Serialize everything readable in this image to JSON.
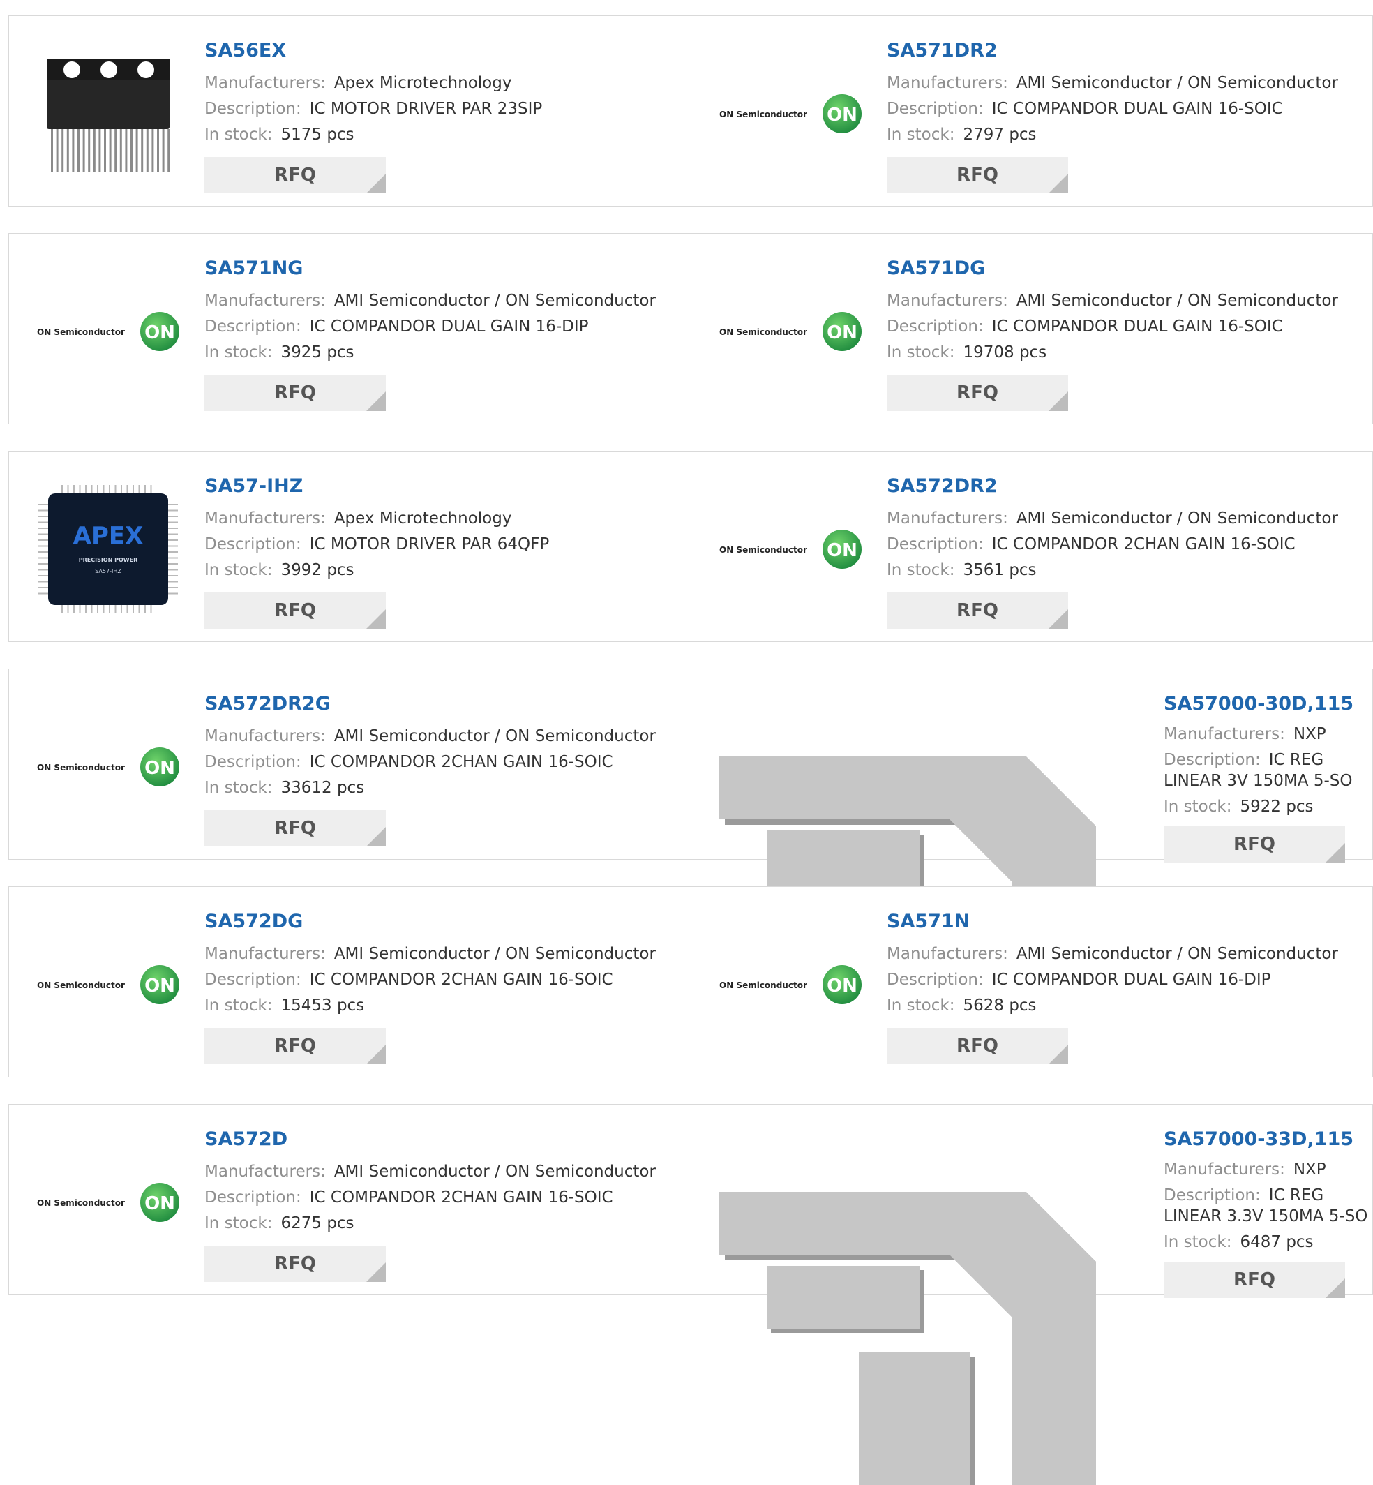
{
  "labels": {
    "manufacturers": "Manufacturers:",
    "description": "Description:",
    "in_stock": "In stock:",
    "rfq": "RFQ"
  },
  "brand_logo": {
    "name": "ON Semiconductor",
    "mark": "ON",
    "color": "#1e8a3e"
  },
  "rows": [
    {
      "left": {
        "image": "ic-23sip",
        "part": "SA56EX",
        "manufacturer": "Apex Microtechnology",
        "description": "IC MOTOR DRIVER PAR 23SIP",
        "stock": "5175 pcs"
      },
      "right": {
        "image": "on-semi-logo",
        "part": "SA571DR2",
        "manufacturer": "AMI Semiconductor / ON Semiconductor",
        "description": "IC COMPANDOR DUAL GAIN 16-SOIC",
        "stock": "2797 pcs"
      }
    },
    {
      "left": {
        "image": "on-semi-logo",
        "part": "SA571NG",
        "manufacturer": "AMI Semiconductor / ON Semiconductor",
        "description": "IC COMPANDOR DUAL GAIN 16-DIP",
        "stock": "3925 pcs"
      },
      "right": {
        "image": "on-semi-logo",
        "part": "SA571DG",
        "manufacturer": "AMI Semiconductor / ON Semiconductor",
        "description": "IC COMPANDOR DUAL GAIN 16-SOIC",
        "stock": "19708 pcs"
      }
    },
    {
      "left": {
        "image": "apex-qfp",
        "part": "SA57-IHZ",
        "manufacturer": "Apex Microtechnology",
        "description": "IC MOTOR DRIVER PAR 64QFP",
        "stock": "3992 pcs",
        "image_text": [
          "APEX",
          "PRECISION POWER",
          "SA57-IHZ"
        ]
      },
      "right": {
        "image": "on-semi-logo",
        "part": "SA572DR2",
        "manufacturer": "AMI Semiconductor / ON Semiconductor",
        "description": "IC COMPANDOR 2CHAN GAIN 16-SOIC",
        "stock": "3561 pcs"
      }
    },
    {
      "left": {
        "image": "on-semi-logo",
        "part": "SA572DR2G",
        "manufacturer": "AMI Semiconductor / ON Semiconductor",
        "description": "IC COMPANDOR 2CHAN GAIN 16-SOIC",
        "stock": "33612 pcs"
      },
      "right": {
        "image": "placeholder",
        "part": "SA57000-30D,115",
        "manufacturer": "NXP",
        "description": "IC REG LINEAR 3V 150MA 5-SO",
        "stock": "5922 pcs"
      }
    },
    {
      "left": {
        "image": "on-semi-logo",
        "part": "SA572DG",
        "manufacturer": "AMI Semiconductor / ON Semiconductor",
        "description": "IC COMPANDOR 2CHAN GAIN 16-SOIC",
        "stock": "15453 pcs"
      },
      "right": {
        "image": "on-semi-logo",
        "part": "SA571N",
        "manufacturer": "AMI Semiconductor / ON Semiconductor",
        "description": "IC COMPANDOR DUAL GAIN 16-DIP",
        "stock": "5628 pcs"
      }
    },
    {
      "left": {
        "image": "on-semi-logo",
        "part": "SA572D",
        "manufacturer": "AMI Semiconductor / ON Semiconductor",
        "description": "IC COMPANDOR 2CHAN GAIN 16-SOIC",
        "stock": "6275 pcs"
      },
      "right": {
        "image": "placeholder",
        "part": "SA57000-33D,115",
        "manufacturer": "NXP",
        "description": "IC REG LINEAR 3.3V 150MA 5-SO",
        "stock": "6487 pcs"
      }
    }
  ]
}
